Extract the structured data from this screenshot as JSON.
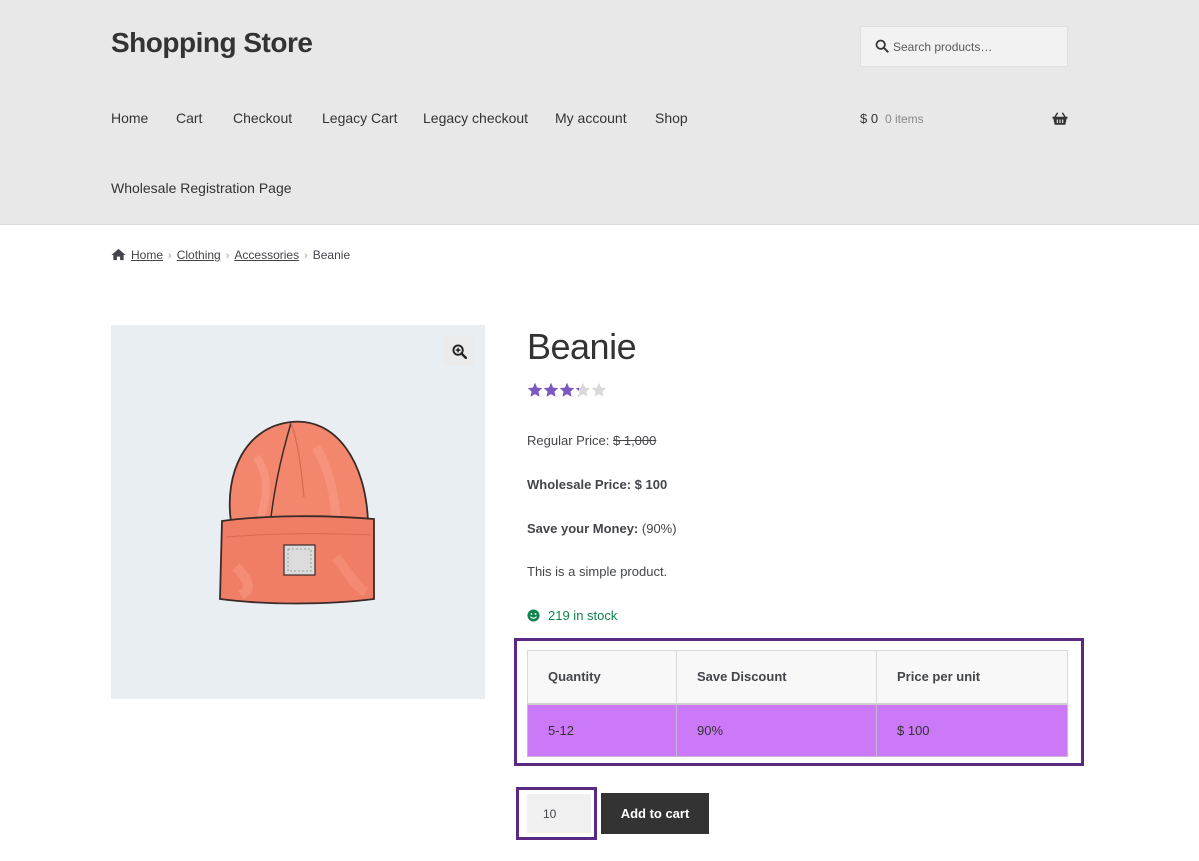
{
  "header": {
    "site_title": "Shopping Store",
    "search_placeholder": "Search products…",
    "nav": [
      "Home",
      "Cart",
      "Checkout",
      "Legacy Cart",
      "Legacy checkout",
      "My account",
      "Shop"
    ],
    "nav_second_row": "Wholesale Registration Page",
    "cart": {
      "amount": "$ 0",
      "items": "0 items"
    }
  },
  "breadcrumb": {
    "items": [
      "Home",
      "Clothing",
      "Accessories"
    ],
    "current": "Beanie"
  },
  "product": {
    "title": "Beanie",
    "rating_fraction": 0.65,
    "regular_price_label": "Regular Price:",
    "regular_price": "$ 1,000",
    "wholesale_price_label": "Wholesale Price: $ 100",
    "save_label": "Save your Money:",
    "save_value": "(90%)",
    "description": "This is a simple product.",
    "stock": "219 in stock",
    "image_alt": "beanie"
  },
  "tier_table": {
    "headers": [
      "Quantity",
      "Save Discount",
      "Price per unit"
    ],
    "rows": [
      [
        "5-12",
        "90%",
        "$ 100"
      ]
    ]
  },
  "cart_form": {
    "quantity": "10",
    "add_to_cart_label": "Add to cart"
  },
  "colors": {
    "header_bg": "#e8e8e8",
    "star": "#7e57c2",
    "stock": "#0f834d",
    "tier_row": "#cc79f7",
    "highlight_border": "#5a2a82",
    "button": "#333333"
  }
}
